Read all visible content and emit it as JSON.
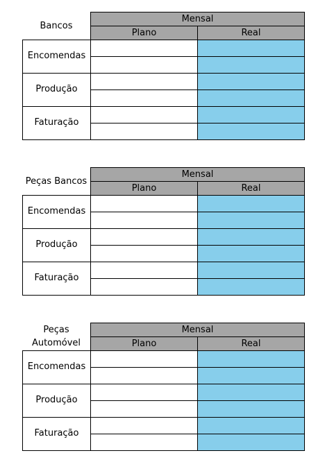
{
  "tables": [
    {
      "title": "Bancos",
      "period_header": "Mensal",
      "col_plano": "Plano",
      "col_real": "Real",
      "rows": [
        "Encomendas",
        "Produção",
        "Faturação"
      ]
    },
    {
      "title": "Peças Bancos",
      "period_header": "Mensal",
      "col_plano": "Plano",
      "col_real": "Real",
      "rows": [
        "Encomendas",
        "Produção",
        "Faturação"
      ]
    },
    {
      "title": "Peças\nAutomóvel",
      "period_header": "Mensal",
      "col_plano": "Plano",
      "col_real": "Real",
      "rows": [
        "Encomendas",
        "Produção",
        "Faturação"
      ]
    }
  ],
  "colors": {
    "header_fill": "#a6a6a6",
    "real_fill": "#87ceeb",
    "plano_fill": "#ffffff"
  }
}
